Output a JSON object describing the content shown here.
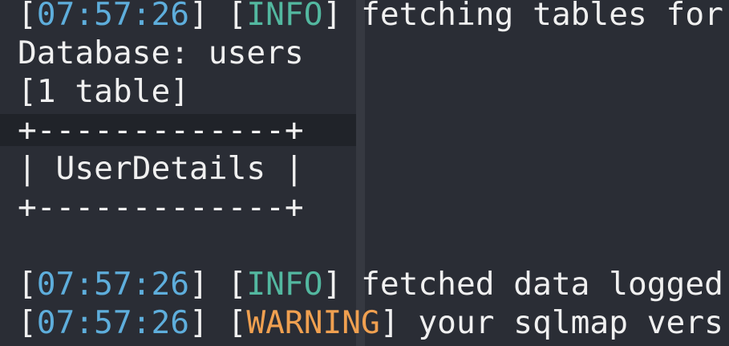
{
  "terminal": {
    "lines": [
      {
        "open": "[",
        "timestamp": "07:57:26",
        "mid": "] [",
        "level": "INFO",
        "close": "] ",
        "message": "fetching tables for"
      },
      {
        "text": "Database: users"
      },
      {
        "text": "[1 table]"
      },
      {
        "text": "+-------------+"
      },
      {
        "text": "| UserDetails |"
      },
      {
        "text": "+-------------+"
      },
      {
        "text": ""
      },
      {
        "open": "[",
        "timestamp": "07:57:26",
        "mid": "] [",
        "level": "INFO",
        "close": "] ",
        "message": "fetched data logged"
      },
      {
        "open": "[",
        "timestamp": "07:57:26",
        "mid": "] [",
        "level": "WARNING",
        "close": "] ",
        "message": "your sqlmap vers"
      }
    ]
  },
  "colors": {
    "background": "#2a2d35",
    "timestamp": "#5eaedc",
    "info": "#53b8a0",
    "warning": "#f0a050",
    "text": "#f0f0f0"
  }
}
